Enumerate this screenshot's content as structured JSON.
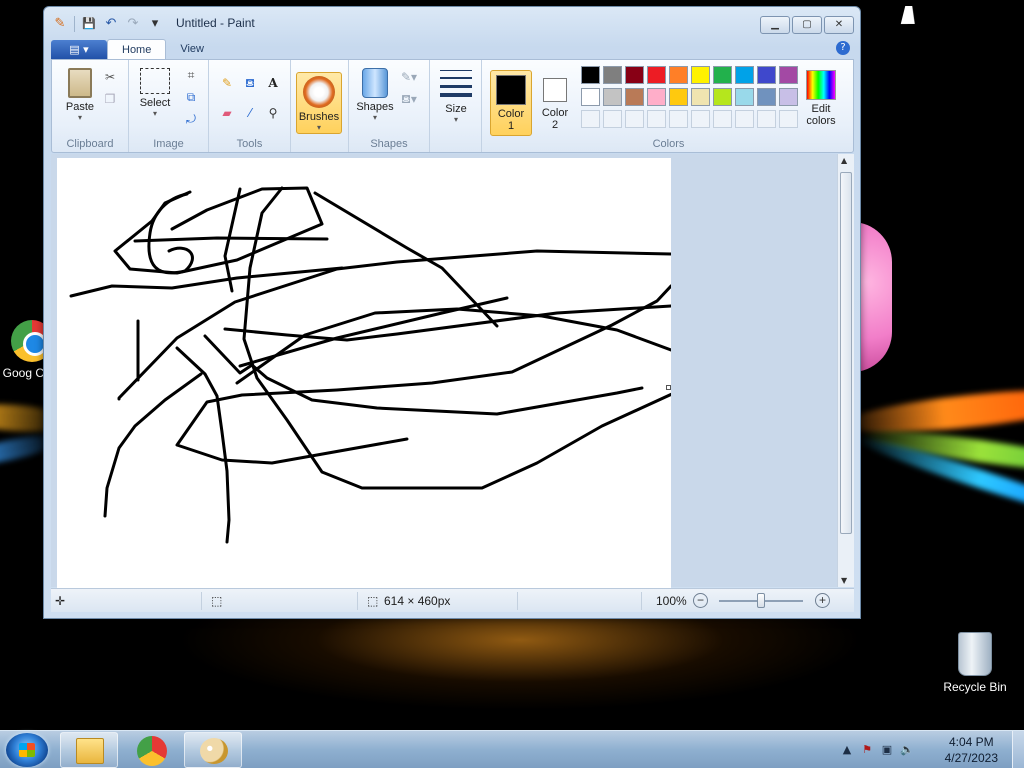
{
  "desktop": {
    "icons": [
      {
        "label": "Goog Chro",
        "icon": "chrome-icon"
      },
      {
        "label": "Recycle Bin",
        "icon": "recycle-bin-icon"
      }
    ]
  },
  "window": {
    "title": "Untitled - Paint",
    "controls": {
      "minimize": "▁",
      "maximize": "▢",
      "close": "✕"
    },
    "qat": {
      "save": "💾",
      "undo": "↶",
      "redo": "↷",
      "customize": "▾"
    },
    "tabs": [
      "Home",
      "View"
    ],
    "active_tab": "Home",
    "app_menu": "▤ ▾",
    "help": "?"
  },
  "ribbon": {
    "clipboard": {
      "label": "Clipboard",
      "paste": "Paste"
    },
    "image": {
      "label": "Image",
      "select": "Select"
    },
    "tools": {
      "label": "Tools"
    },
    "brushes": {
      "label": "Brushes"
    },
    "shapes": {
      "label": "Shapes",
      "button": "Shapes"
    },
    "size": {
      "label": "Size"
    },
    "colors": {
      "label": "Colors",
      "color1": "Color\n1",
      "color1_a": "Color",
      "color1_b": "1",
      "color2_a": "Color",
      "color2_b": "2",
      "color1_value": "#000000",
      "color2_value": "#ffffff",
      "edit_a": "Edit",
      "edit_b": "colors",
      "palette_row1": [
        "#000000",
        "#7f7f7f",
        "#880015",
        "#ed1c24",
        "#ff7f27",
        "#fff200",
        "#22b14c",
        "#00a2e8",
        "#3f48cc",
        "#a349a4"
      ],
      "palette_row2": [
        "#ffffff",
        "#c3c3c3",
        "#b97a57",
        "#ffaec9",
        "#ffc90e",
        "#efe4b0",
        "#b5e61d",
        "#99d9ea",
        "#7092be",
        "#c8bfe7"
      ]
    }
  },
  "status": {
    "dimensions": "614 × 460px",
    "zoom": "100%",
    "zoom_out": "−",
    "zoom_in": "+"
  },
  "taskbar": {
    "time": "4:04 PM",
    "date": "4/27/2023",
    "apps": [
      "explorer-icon",
      "chrome-icon",
      "paint-icon"
    ]
  }
}
